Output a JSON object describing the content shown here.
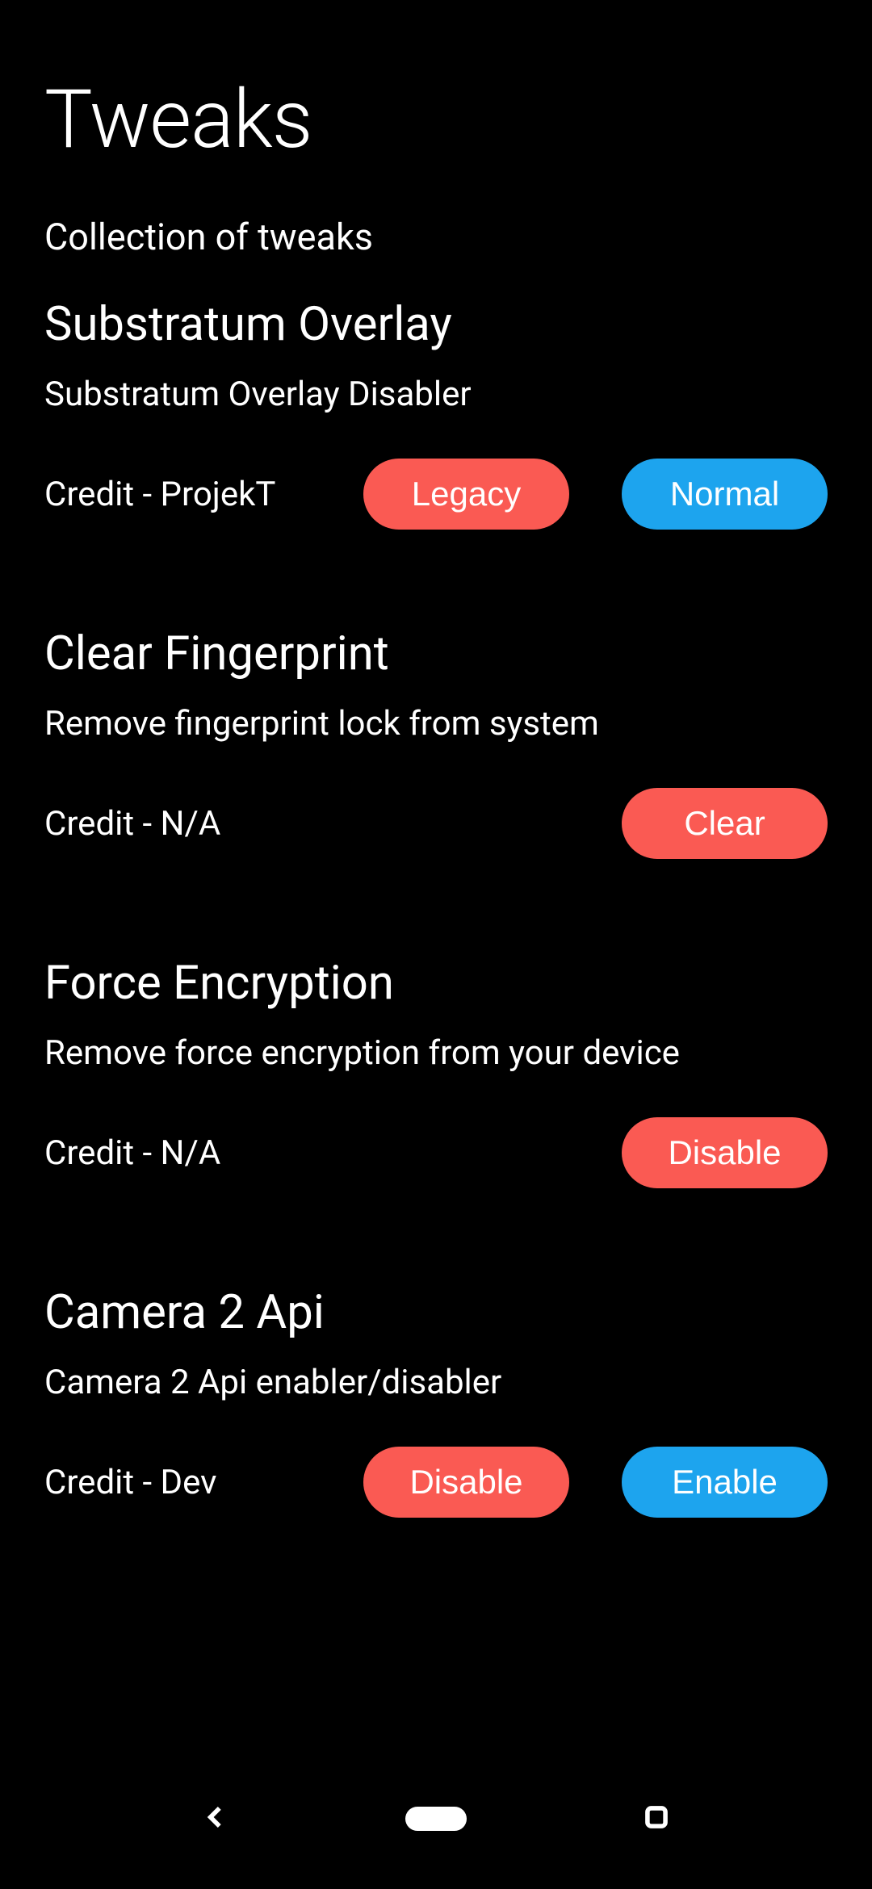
{
  "header": {
    "title": "Tweaks",
    "subtitle": "Collection of tweaks"
  },
  "tweaks": {
    "substratum": {
      "title": "Substratum Overlay",
      "desc": "Substratum Overlay Disabler",
      "credit": "Credit - ProjekT",
      "btn_primary": "Legacy",
      "btn_secondary": "Normal"
    },
    "fingerprint": {
      "title": "Clear Fingerprint",
      "desc": "Remove fingerprint lock from system",
      "credit": "Credit - N/A",
      "btn_primary": "Clear"
    },
    "encryption": {
      "title": "Force Encryption",
      "desc": "Remove force encryption from your device",
      "credit": "Credit - N/A",
      "btn_primary": "Disable"
    },
    "camera2": {
      "title": "Camera 2 Api",
      "desc": "Camera 2 Api enabler/disabler",
      "credit": "Credit - Dev",
      "btn_primary": "Disable",
      "btn_secondary": "Enable"
    }
  }
}
